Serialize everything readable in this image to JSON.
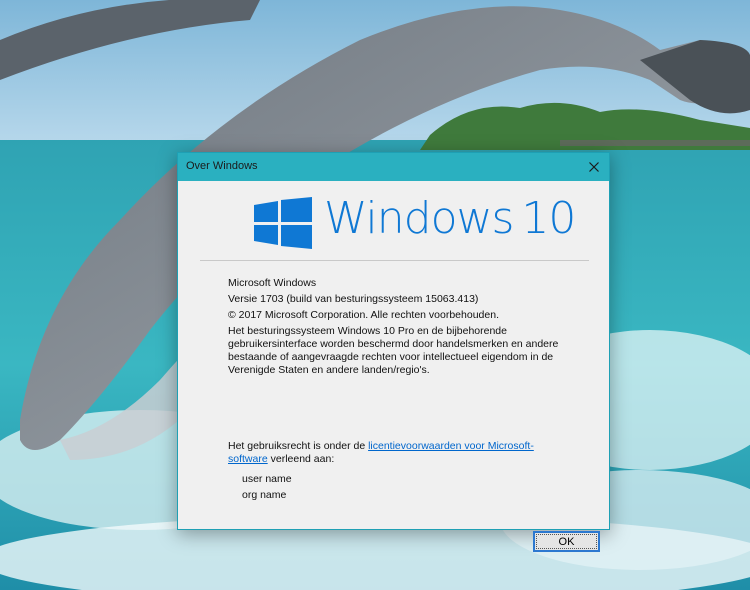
{
  "dialog": {
    "title": "Over Windows",
    "close_icon": "close-icon",
    "logo": {
      "word": "Windows",
      "version": "10",
      "brand_color": "#0f78d4"
    },
    "info": {
      "product": "Microsoft Windows",
      "version": "Versie 1703 (build van besturingssysteem 15063.413)",
      "copyright": "© 2017 Microsoft Corporation. Alle rechten voorbehouden.",
      "description": "Het besturingssysteem Windows 10 Pro en de bijbehorende gebruikersinterface worden beschermd door handelsmerken en andere bestaande of aangevraagde rechten voor intellectueel eigendom in de Verenigde Staten en andere landen/regio's."
    },
    "license": {
      "prefix": "Het gebruiksrecht is onder de ",
      "link": "licentievoorwaarden voor Microsoft-software",
      "suffix": " verleend aan:"
    },
    "licensed_to": {
      "user": "user name",
      "org": "org name"
    },
    "ok_label": "OK"
  },
  "colors": {
    "titlebar": "#2ab0c0",
    "window_bg": "#f0f0f0",
    "link": "#0066cc"
  }
}
